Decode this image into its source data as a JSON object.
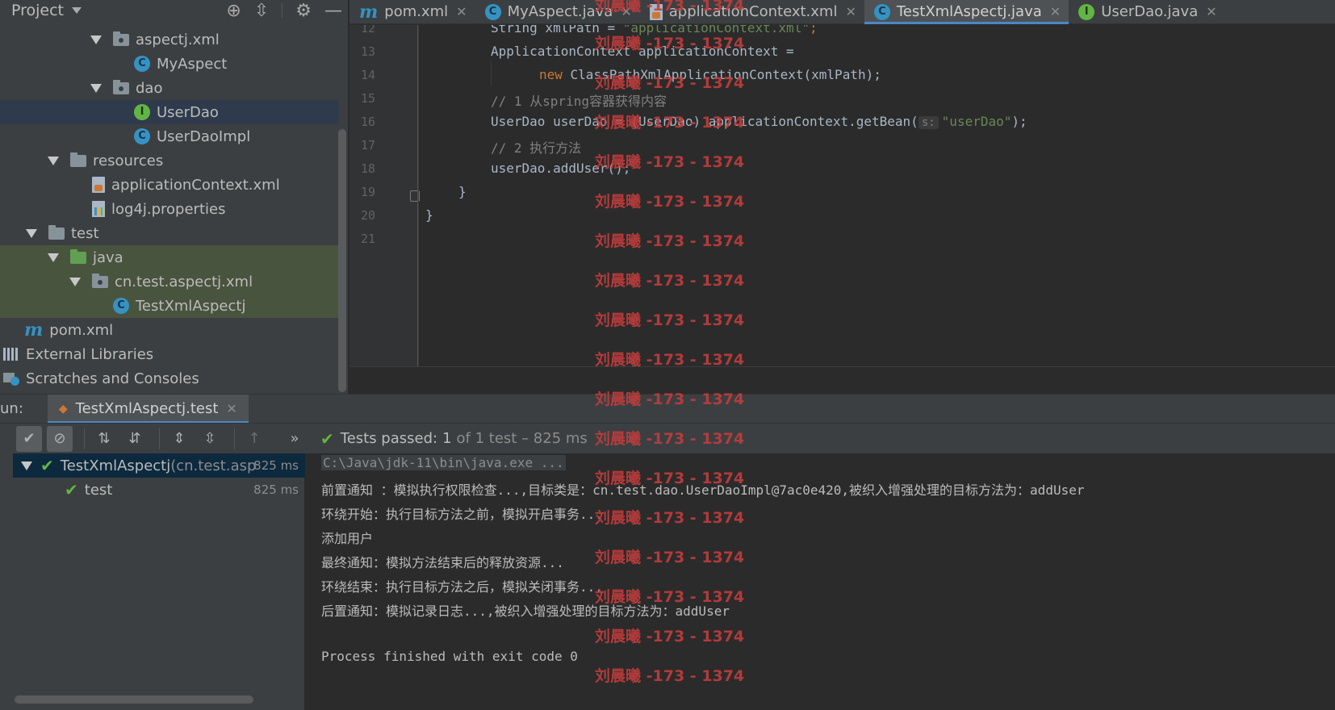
{
  "project": {
    "title": "Project",
    "tree": [
      {
        "label": "aspectj.xml",
        "icon": "package-icon"
      },
      {
        "label": "MyAspect",
        "icon": "class-icon"
      },
      {
        "label": "dao",
        "icon": "package-icon"
      },
      {
        "label": "UserDao",
        "icon": "interface-icon"
      },
      {
        "label": "UserDaoImpl",
        "icon": "class-icon"
      },
      {
        "label": "resources",
        "icon": "resources-folder-icon"
      },
      {
        "label": "applicationContext.xml",
        "icon": "xml-file-icon"
      },
      {
        "label": "log4j.properties",
        "icon": "properties-file-icon"
      },
      {
        "label": "test",
        "icon": "folder-icon"
      },
      {
        "label": "java",
        "icon": "test-source-folder-icon"
      },
      {
        "label": "cn.test.aspectj.xml",
        "icon": "package-icon"
      },
      {
        "label": "TestXmlAspectj",
        "icon": "class-icon"
      },
      {
        "label": "pom.xml",
        "icon": "maven-icon"
      },
      {
        "label": "External Libraries",
        "icon": "libraries-icon"
      },
      {
        "label": "Scratches and Consoles",
        "icon": "scratches-icon"
      }
    ]
  },
  "tabs": [
    {
      "label": "pom.xml",
      "icon": "maven-icon"
    },
    {
      "label": "MyAspect.java",
      "icon": "class-icon"
    },
    {
      "label": "applicationContext.xml",
      "icon": "xml-file-icon"
    },
    {
      "label": "TestXmlAspectj.java",
      "icon": "class-icon",
      "active": true
    },
    {
      "label": "UserDao.java",
      "icon": "interface-icon"
    }
  ],
  "editor": {
    "line_numbers": [
      "12",
      "13",
      "14",
      "15",
      "16",
      "17",
      "18",
      "19",
      "20",
      "21"
    ],
    "lines": {
      "l12_pre": "String xmlPath = ",
      "l12_str": "\"applicationContext.xml\"",
      "l12_post": ";",
      "l13": "ApplicationContext applicationContext =",
      "l14_kw": "new",
      "l14_rest": " ClassPathXmlApplicationContext(xmlPath);",
      "l15": "// 1 从spring容器获得内容",
      "l16_pre": "UserDao userDao = (UserDao) applicationContext.getBean(",
      "l16_hint": "s:",
      "l16_str": "\"userDao\"",
      "l16_post": ");",
      "l17": "// 2 执行方法",
      "l18": "userDao.addUser();",
      "l19": "}",
      "l20": "}"
    }
  },
  "run": {
    "label": "un:",
    "tab": "TestXmlAspectj.test",
    "status_label": "Tests passed:",
    "status_count": "1",
    "status_total": "of 1 test – 825 ms",
    "tree": [
      {
        "name": "TestXmlAspectj",
        "pkg": " (cn.test.asp",
        "time": "825 ms"
      },
      {
        "name": "test",
        "pkg": "",
        "time": "825 ms"
      }
    ],
    "console": [
      "C:\\Java\\jdk-11\\bin\\java.exe ...",
      "前置通知 ：模拟执行权限检查...,目标类是：cn.test.dao.UserDaoImpl@7ac0e420,被织入增强处理的目标方法为：addUser",
      "环绕开始：执行目标方法之前，模拟开启事务...",
      "添加用户",
      "最终通知：模拟方法结束后的释放资源...",
      "环绕结束：执行目标方法之后，模拟关闭事务...",
      "后置通知：模拟记录日志...,被织入增强处理的目标方法为：addUser",
      "",
      "Process finished with exit code 0"
    ]
  },
  "watermark": "刘晨曦 -173 - 1374",
  "colors": {
    "accent": "#4a88c7",
    "pass": "#62b543",
    "string": "#6a8759",
    "keyword": "#cc7832",
    "watermark": "#c23c3c"
  }
}
